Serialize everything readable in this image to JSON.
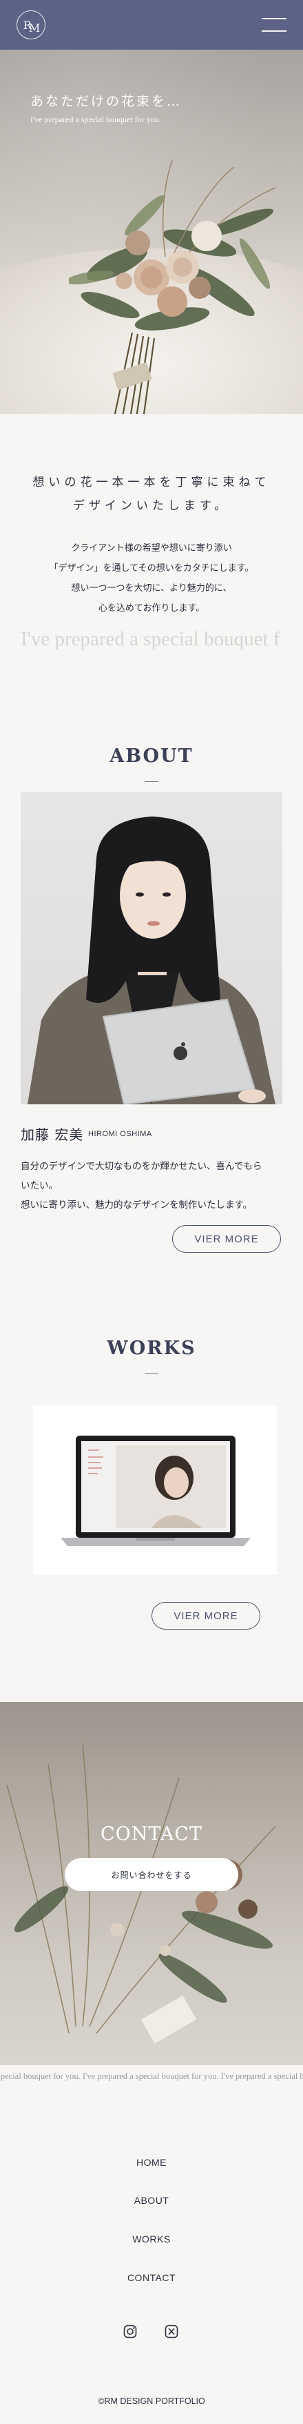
{
  "header": {
    "logo_text_r": "R",
    "logo_text_m": "M",
    "logo_icon": "rm-monogram-logo",
    "menu_icon": "hamburger-menu-icon"
  },
  "hero": {
    "title": "あなただけの花束を…",
    "subtitle": "I've prepared a special bouquet for you."
  },
  "intro": {
    "heading_line1": "想いの花一本一本を丁寧に束ねて",
    "heading_line2": "デザインいたします。",
    "body_line1": "クライアント様の希望や想いに寄り添い",
    "body_line2": "「デザイン」を通してその想いをカタチにします。",
    "body_line3": "想い一つ一つを大切に、より魅力的に、",
    "body_line4": "心を込めてお作りします。",
    "marquee": "I've prepared a special bouquet f"
  },
  "about": {
    "title": "ABOUT",
    "name": "加藤 宏美",
    "name_en": "HIROMI OSHIMA",
    "bio_line1": "自分のデザインで大切なものをか輝かせたい、喜んでもら",
    "bio_line2": "いたい。",
    "bio_line3": "想いに寄り添い、魅力的なデザインを制作いたします。",
    "more_label": "VIER MORE"
  },
  "works": {
    "title": "WORKS",
    "more_label": "VIER MORE"
  },
  "contact": {
    "title": "CONTACT",
    "button_label": "お問い合わせをする"
  },
  "marquee_bottom": "special bouquet for you.  I've prepared a special bouquet for you.  I've prepared a special bouquet for you.  I've prepared a",
  "footer": {
    "nav": [
      "HOME",
      "ABOUT",
      "WORKS",
      "CONTACT"
    ],
    "social": [
      {
        "name": "instagram-icon"
      },
      {
        "name": "x-twitter-icon"
      }
    ],
    "copyright": "©RM DESIGN PORTFOLIO"
  },
  "colors": {
    "header_bg": "#5b6285",
    "text": "#2c2f3f",
    "accent": "#4d5270",
    "page_bg": "#f7f6f4"
  }
}
